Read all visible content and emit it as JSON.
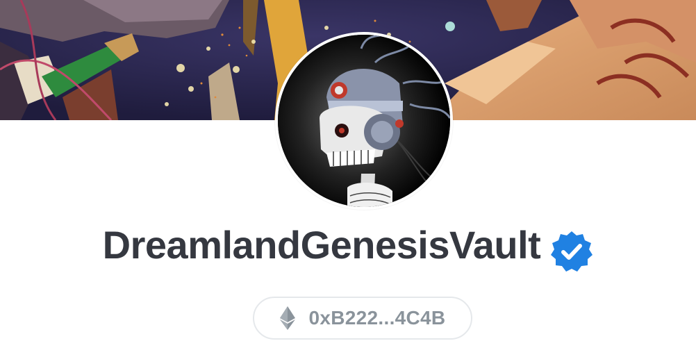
{
  "profile": {
    "name": "DreamlandGenesisVault",
    "verified": true,
    "verified_icon": "verified-badge-icon",
    "address": "0xB222...4C4B",
    "chain_icon": "ethereum-icon"
  },
  "colors": {
    "title": "#353840",
    "address_text": "#8a939b",
    "pill_border": "#e5e8eb",
    "verified_blue": "#2081e2"
  }
}
